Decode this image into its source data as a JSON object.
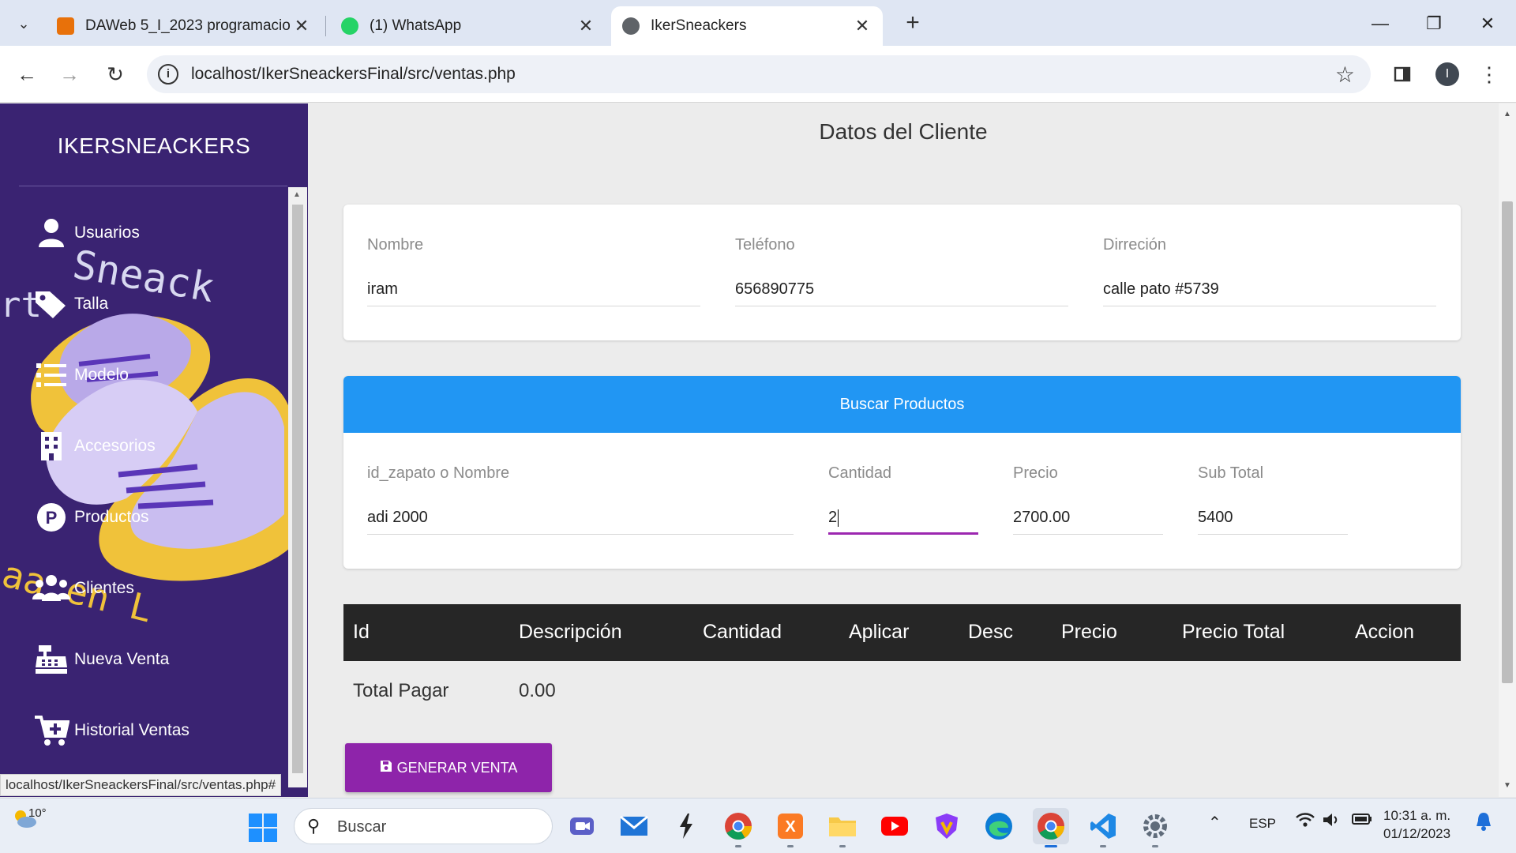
{
  "browser": {
    "tabs": [
      {
        "title": "DAWeb 5_I_2023 programacio",
        "close": "✕"
      },
      {
        "title": "(1) WhatsApp",
        "close": "✕"
      },
      {
        "title": "IkerSneackers",
        "close": "✕"
      }
    ],
    "url": "localhost/IkerSneackersFinal/src/ventas.php",
    "profile_initial": "I",
    "status_url": "localhost/IkerSneackersFinal/src/ventas.php#"
  },
  "sidebar": {
    "brand": "IKERSNEACKERS",
    "items": [
      {
        "label": "Usuarios",
        "icon": "user-icon"
      },
      {
        "label": "Talla",
        "icon": "tags-icon"
      },
      {
        "label": "Modelo",
        "icon": "list-icon"
      },
      {
        "label": "Accesorios",
        "icon": "building-icon"
      },
      {
        "label": "Productos",
        "icon": "product-p-icon"
      },
      {
        "label": "Clientes",
        "icon": "users-icon"
      },
      {
        "label": "Nueva Venta",
        "icon": "cash-register-icon"
      },
      {
        "label": "Historial Ventas",
        "icon": "cart-plus-icon"
      }
    ]
  },
  "main": {
    "title": "Datos del Cliente",
    "cliente": {
      "nombre_label": "Nombre",
      "nombre_value": "iram",
      "telefono_label": "Teléfono",
      "telefono_value": "656890775",
      "direccion_label": "Dirreción",
      "direccion_value": "calle pato #5739"
    },
    "productos": {
      "header": "Buscar Productos",
      "search_label": "id_zapato o Nombre",
      "search_value": "adi 2000",
      "cantidad_label": "Cantidad",
      "cantidad_value": "2",
      "precio_label": "Precio",
      "precio_value": "2700.00",
      "subtotal_label": "Sub Total",
      "subtotal_value": "5400"
    },
    "table": {
      "columns": [
        "Id",
        "Descripción",
        "Cantidad",
        "Aplicar",
        "Desc",
        "Precio",
        "Precio Total",
        "Accion"
      ]
    },
    "total_label": "Total Pagar",
    "total_value": "0.00",
    "generar_button": "GENERAR VENTA"
  },
  "taskbar": {
    "weather_temp": "10°",
    "search_placeholder": "Buscar",
    "language": "ESP",
    "time": "10:31 a. m.",
    "date": "01/12/2023"
  },
  "colors": {
    "sidebar_bg": "#3a2372",
    "accent_blue": "#2196f3",
    "accent_purple": "#8e24aa",
    "table_header": "#262626"
  }
}
